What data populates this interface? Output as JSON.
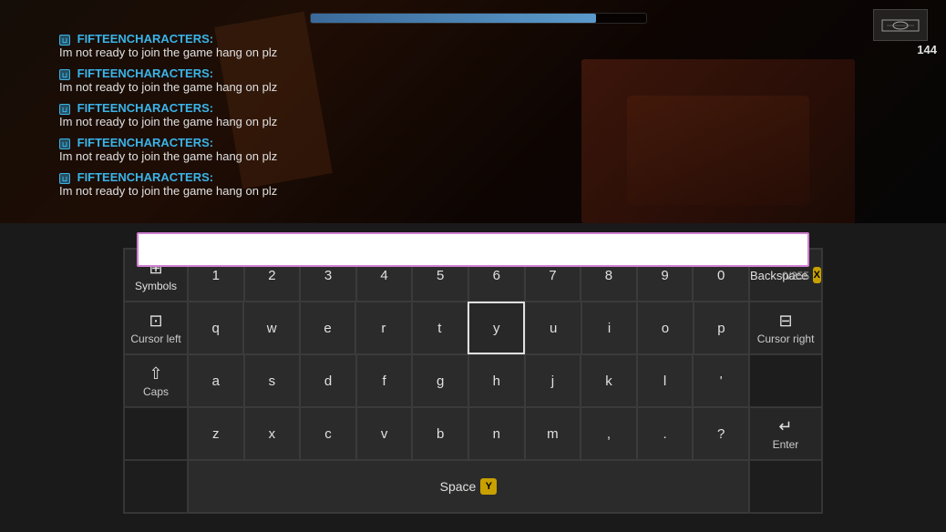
{
  "game": {
    "progress_bar_width": "85%",
    "minimap_count": "144",
    "chat_lines": [
      {
        "username": "FIFTEENCHARACTERS:",
        "message": "Im not ready to join the game hang on plz"
      },
      {
        "username": "FIFTEENCHARACTERS:",
        "message": "Im not ready to join the game hang on plz"
      },
      {
        "username": "FIFTEENCHARACTERS:",
        "message": "Im not ready to join the game hang on plz"
      },
      {
        "username": "FIFTEENCHARACTERS:",
        "message": "Im not ready to join the game hang on plz"
      },
      {
        "username": "FIFTEENCHARACTERS:",
        "message": "Im not ready to join the game hang on plz"
      }
    ]
  },
  "text_input": {
    "value": "",
    "placeholder": "",
    "char_count": "0/255"
  },
  "keyboard": {
    "rows": [
      {
        "keys": [
          "Symbols",
          "1",
          "2",
          "3",
          "4",
          "5",
          "6",
          "7",
          "8",
          "9",
          "0",
          "Backspace"
        ]
      },
      {
        "keys": [
          "Cursor left",
          "q",
          "w",
          "e",
          "r",
          "t",
          "y",
          "u",
          "i",
          "o",
          "p",
          "Cursor right"
        ]
      },
      {
        "keys": [
          "Caps",
          "a",
          "s",
          "d",
          "f",
          "g",
          "h",
          "j",
          "k",
          "l",
          "'",
          ""
        ]
      },
      {
        "keys": [
          "",
          "z",
          "x",
          "c",
          "v",
          "b",
          "n",
          "m",
          ",",
          ".",
          "?",
          "Enter"
        ]
      }
    ],
    "space_label": "Space",
    "selected_key": "y",
    "backspace_label": "Backspace",
    "enter_label": "Enter",
    "cursor_left_label": "Cursor left",
    "cursor_right_label": "Cursor right",
    "caps_label": "Caps",
    "symbols_label": "Symbols"
  }
}
